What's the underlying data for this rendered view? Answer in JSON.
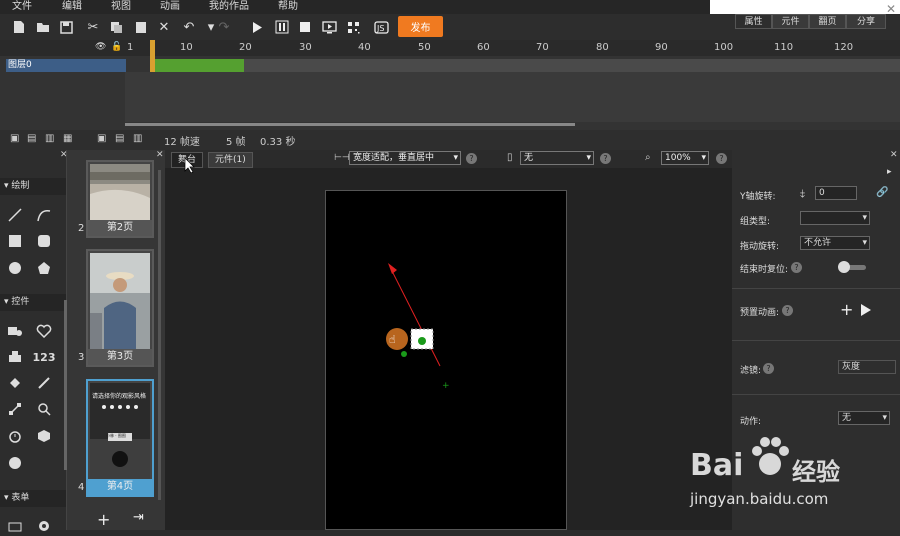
{
  "menu": [
    "文件",
    "编辑",
    "视图",
    "动画",
    "我的作品",
    "帮助"
  ],
  "notification": {
    "close": "✕"
  },
  "toolbar": {
    "publish": "发布"
  },
  "timeline": {
    "ruler": [
      "1",
      "10",
      "20",
      "30",
      "40",
      "50",
      "60",
      "70",
      "80",
      "90",
      "100",
      "110",
      "120"
    ],
    "layer_name": "图层0"
  },
  "timeline_status": {
    "fps": "12 帧速",
    "frames": "5 帧",
    "seconds": "0.33 秒"
  },
  "left_sections": {
    "draw": "绘制",
    "controls": "控件",
    "forms": "表单"
  },
  "pages": [
    {
      "num": "2",
      "label": "第2页"
    },
    {
      "num": "3",
      "label": "第3页"
    },
    {
      "num": "4",
      "label": "第4页"
    }
  ],
  "thumb4_text": "请选择你的观影风格",
  "thumb4_text2": "小林 · 图图",
  "stage_tabs": [
    "舞台",
    "元件(1)"
  ],
  "fit_mode": "宽度适配，垂直居中",
  "device": "无",
  "zoom": "100%",
  "right": {
    "tabs": [
      "属性",
      "元件",
      "翻页",
      "分享"
    ],
    "y_rotate_label": "Y轴旋转:",
    "y_rotate_value": "0",
    "group_type_label": "组类型:",
    "drag_rotate_label": "拖动旋转:",
    "drag_rotate_value": "不允许",
    "reset_label": "结束时复位:",
    "preset_label": "预置动画:",
    "filter_label": "滤镜:",
    "filter_value": "灰度",
    "action_label": "动作:",
    "action_value": "无"
  },
  "watermark": {
    "brand": "Bai",
    "brand2": "经验",
    "url": "jingyan.baidu.com"
  },
  "colors": {
    "accent": "#f07a20",
    "layer": "#3d5e87",
    "frames": "#55a030"
  }
}
